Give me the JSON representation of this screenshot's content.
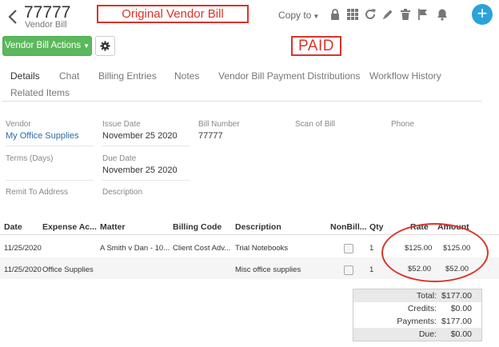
{
  "header": {
    "bill_number": "77777",
    "bill_type": "Vendor Bill",
    "copy_to_label": "Copy to",
    "actions_label": "Vendor Bill Actions"
  },
  "annotations": {
    "original_label": "Original Vendor Bill",
    "paid_label": "PAID"
  },
  "toolbar_icons": [
    "lock-icon",
    "grid-icon",
    "refresh-icon",
    "pencil-icon",
    "trash-icon",
    "flag-icon",
    "bell-icon",
    "plus-icon"
  ],
  "tabs": [
    {
      "label": "Details",
      "active": true
    },
    {
      "label": "Chat"
    },
    {
      "label": "Billing Entries"
    },
    {
      "label": "Notes"
    },
    {
      "label": "Vendor Bill Payment Distributions"
    },
    {
      "label": "Workflow History"
    },
    {
      "label": "Related Items"
    }
  ],
  "fields": {
    "vendor": {
      "label": "Vendor",
      "value": "My Office Supplies"
    },
    "issue_date": {
      "label": "Issue Date",
      "value": "November 25 2020"
    },
    "bill_number": {
      "label": "Bill Number",
      "value": "77777"
    },
    "scan_of_bill": {
      "label": "Scan of Bill",
      "value": ""
    },
    "phone": {
      "label": "Phone",
      "value": ""
    },
    "terms": {
      "label": "Terms (Days)",
      "value": ""
    },
    "due_date": {
      "label": "Due Date",
      "value": "November 25 2020"
    },
    "remit_to": {
      "label": "Remit To Address",
      "value": ""
    },
    "description": {
      "label": "Description",
      "value": ""
    }
  },
  "table": {
    "columns": [
      "Date",
      "Expense Ac...",
      "Matter",
      "Billing Code",
      "Description",
      "NonBill...",
      "Qty",
      "Rate",
      "Amount"
    ],
    "rows": [
      {
        "date": "11/25/2020",
        "expense_account": "",
        "matter": "A Smith v Dan - 10...",
        "billing_code": "Client Cost Adv...",
        "description": "Trial Notebooks",
        "qty": "1",
        "rate": "$125.00",
        "amount": "$125.00"
      },
      {
        "date": "11/25/2020",
        "expense_account": "Office Supplies",
        "matter": "",
        "billing_code": "",
        "description": "Misc office supplies",
        "qty": "1",
        "rate": "$52.00",
        "amount": "$52.00"
      }
    ]
  },
  "totals": {
    "total_label": "Total:",
    "total": "$177.00",
    "credits_label": "Credits:",
    "credits": "$0.00",
    "payments_label": "Payments:",
    "payments": "$177.00",
    "due_label": "Due:",
    "due": "$0.00"
  },
  "colors": {
    "accent_green": "#5cb85c",
    "accent_blue": "#2aa3d8",
    "annotation_red": "#d9342b",
    "link": "#2d6aa8"
  }
}
